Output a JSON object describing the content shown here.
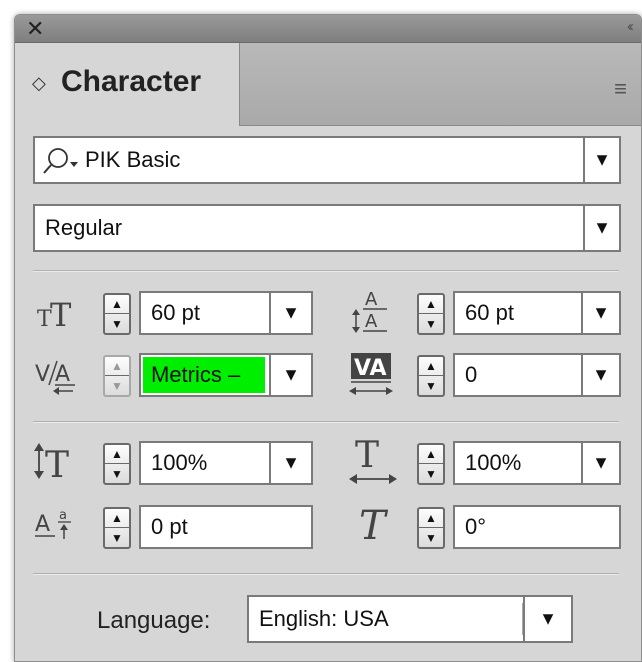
{
  "window": {
    "close_glyph": "✕",
    "collapse_glyph": "‹‹"
  },
  "tab": {
    "arrows": "◇",
    "label": "Character",
    "menu_glyph": "≡"
  },
  "font": {
    "family": "PIK Basic",
    "style": "Regular"
  },
  "size": {
    "value": "60 pt"
  },
  "leading": {
    "value": "60 pt"
  },
  "kerning": {
    "value": "Metrics –",
    "highlight": "#00ee00"
  },
  "tracking": {
    "value": "0"
  },
  "vertical_scale": {
    "value": "100%"
  },
  "horizontal_scale": {
    "value": "100%"
  },
  "baseline_shift": {
    "value": "0 pt"
  },
  "skew": {
    "value": "0°"
  },
  "language": {
    "label": "Language:",
    "value": "English: USA"
  },
  "icons": {
    "font_size": "font-size-icon",
    "leading": "leading-icon",
    "kerning": "kerning-icon",
    "tracking": "tracking-icon",
    "vertical_scale": "vertical-scale-icon",
    "horizontal_scale": "horizontal-scale-icon",
    "baseline_shift": "baseline-shift-icon",
    "skew": "skew-icon",
    "search": "search-icon",
    "dropdown": "chevron-down-icon"
  }
}
